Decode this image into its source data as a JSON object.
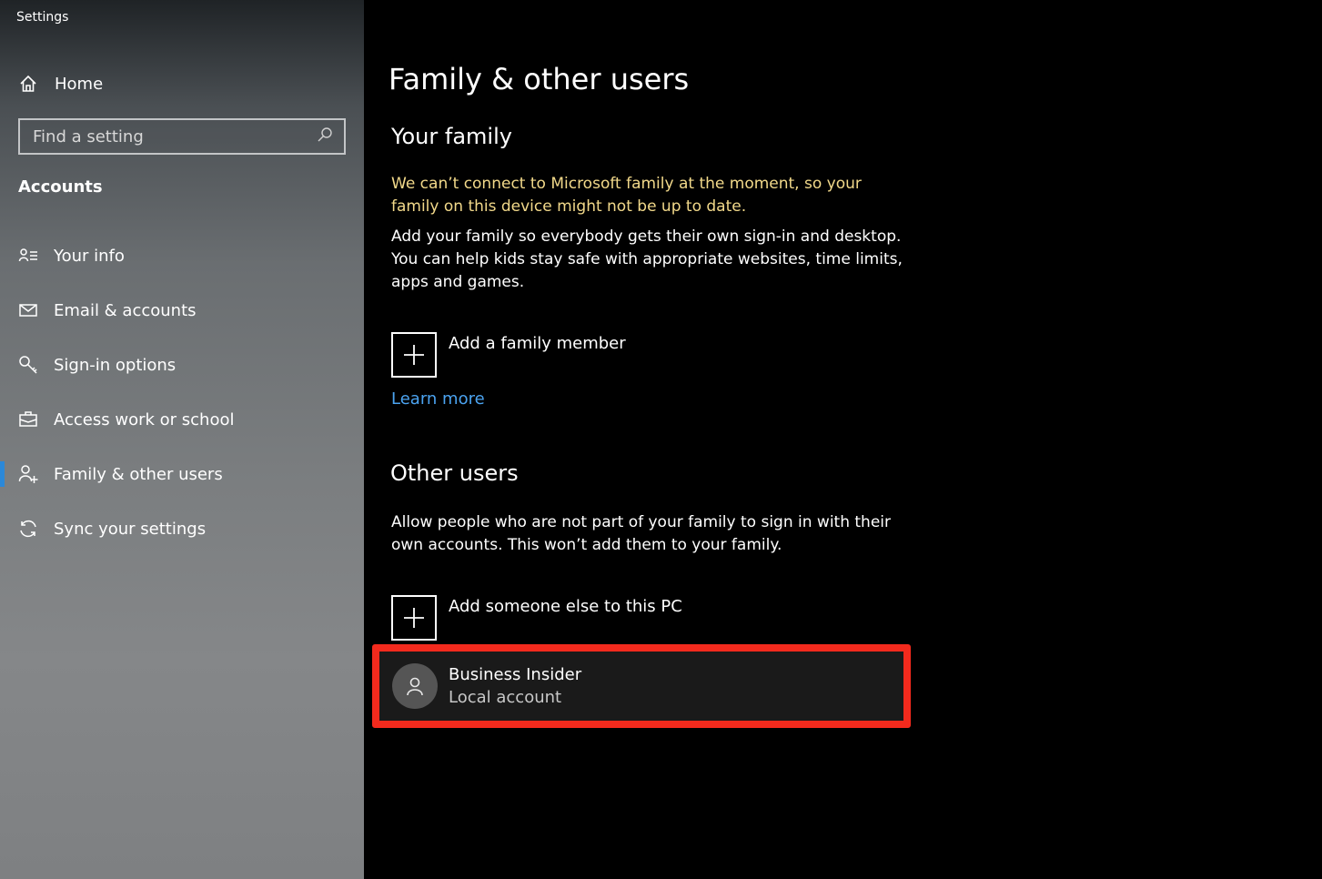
{
  "window": {
    "title": "Settings"
  },
  "sidebar": {
    "home_label": "Home",
    "search_placeholder": "Find a setting",
    "section": "Accounts",
    "items": [
      {
        "label": "Your info",
        "icon": "person-list-icon"
      },
      {
        "label": "Email & accounts",
        "icon": "mail-icon"
      },
      {
        "label": "Sign-in options",
        "icon": "key-icon"
      },
      {
        "label": "Access work or school",
        "icon": "briefcase-icon"
      },
      {
        "label": "Family & other users",
        "icon": "add-person-icon",
        "active": true
      },
      {
        "label": "Sync your settings",
        "icon": "sync-icon"
      }
    ]
  },
  "main": {
    "title": "Family & other users",
    "family": {
      "heading": "Your family",
      "warning": "We can’t connect to Microsoft family at the moment, so your family on this device might not be up to date.",
      "description": "Add your family so everybody gets their own sign-in and desktop. You can help kids stay safe with appropriate websites, time limits, apps and games.",
      "add_label": "Add a family member",
      "learn_more": "Learn more"
    },
    "other": {
      "heading": "Other users",
      "description": "Allow people who are not part of your family to sign in with their own accounts. This won’t add them to your family.",
      "add_label": "Add someone else to this PC",
      "users": [
        {
          "name": "Business Insider",
          "type": "Local account"
        }
      ]
    }
  },
  "colors": {
    "accent": "#2b88d8",
    "warning_text": "#f2d98a",
    "link": "#4ba3f0",
    "highlight_border": "#f32a1d"
  }
}
